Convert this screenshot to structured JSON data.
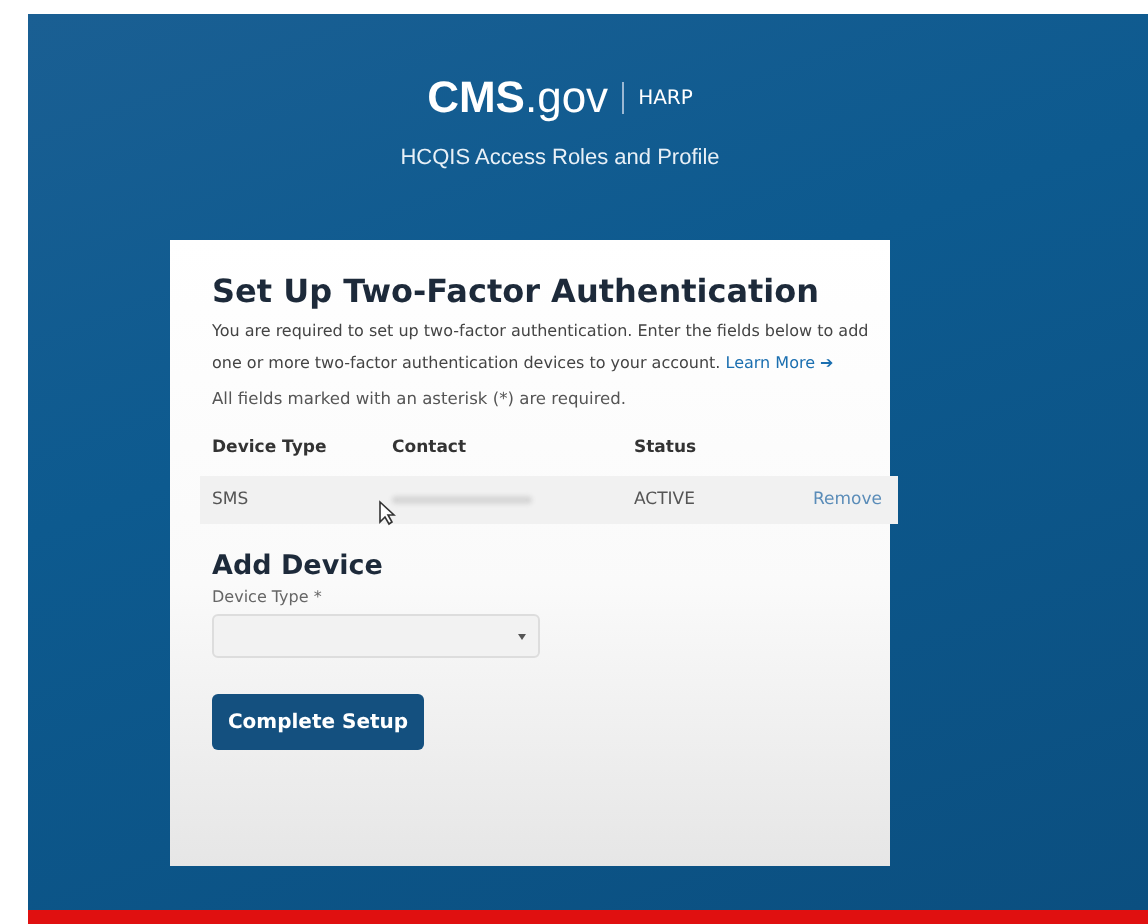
{
  "header": {
    "logo": "**CMS**.gov",
    "product": "HARP",
    "subtitle": "HCQIS Access Roles and Profile"
  },
  "card": {
    "title": "Set Up Two-Factor Authentication",
    "description": "You are required to set up two-factor authentication. Enter the fields below to add one or more two-factor authentication devices to your account.",
    "learn_more": "Learn More ➔",
    "required_note": "All fields marked with an asterisk (*) are required.",
    "table": {
      "columns": [
        "Device Type",
        "Contact",
        "Status"
      ],
      "rows": [
        {
          "device_type": "SMS",
          "contact_redacted": true,
          "status": "ACTIVE",
          "action": "Remove"
        }
      ]
    },
    "add_device": {
      "title": "Add Device",
      "field_label": "Device Type *"
    },
    "button": "Complete Setup"
  }
}
